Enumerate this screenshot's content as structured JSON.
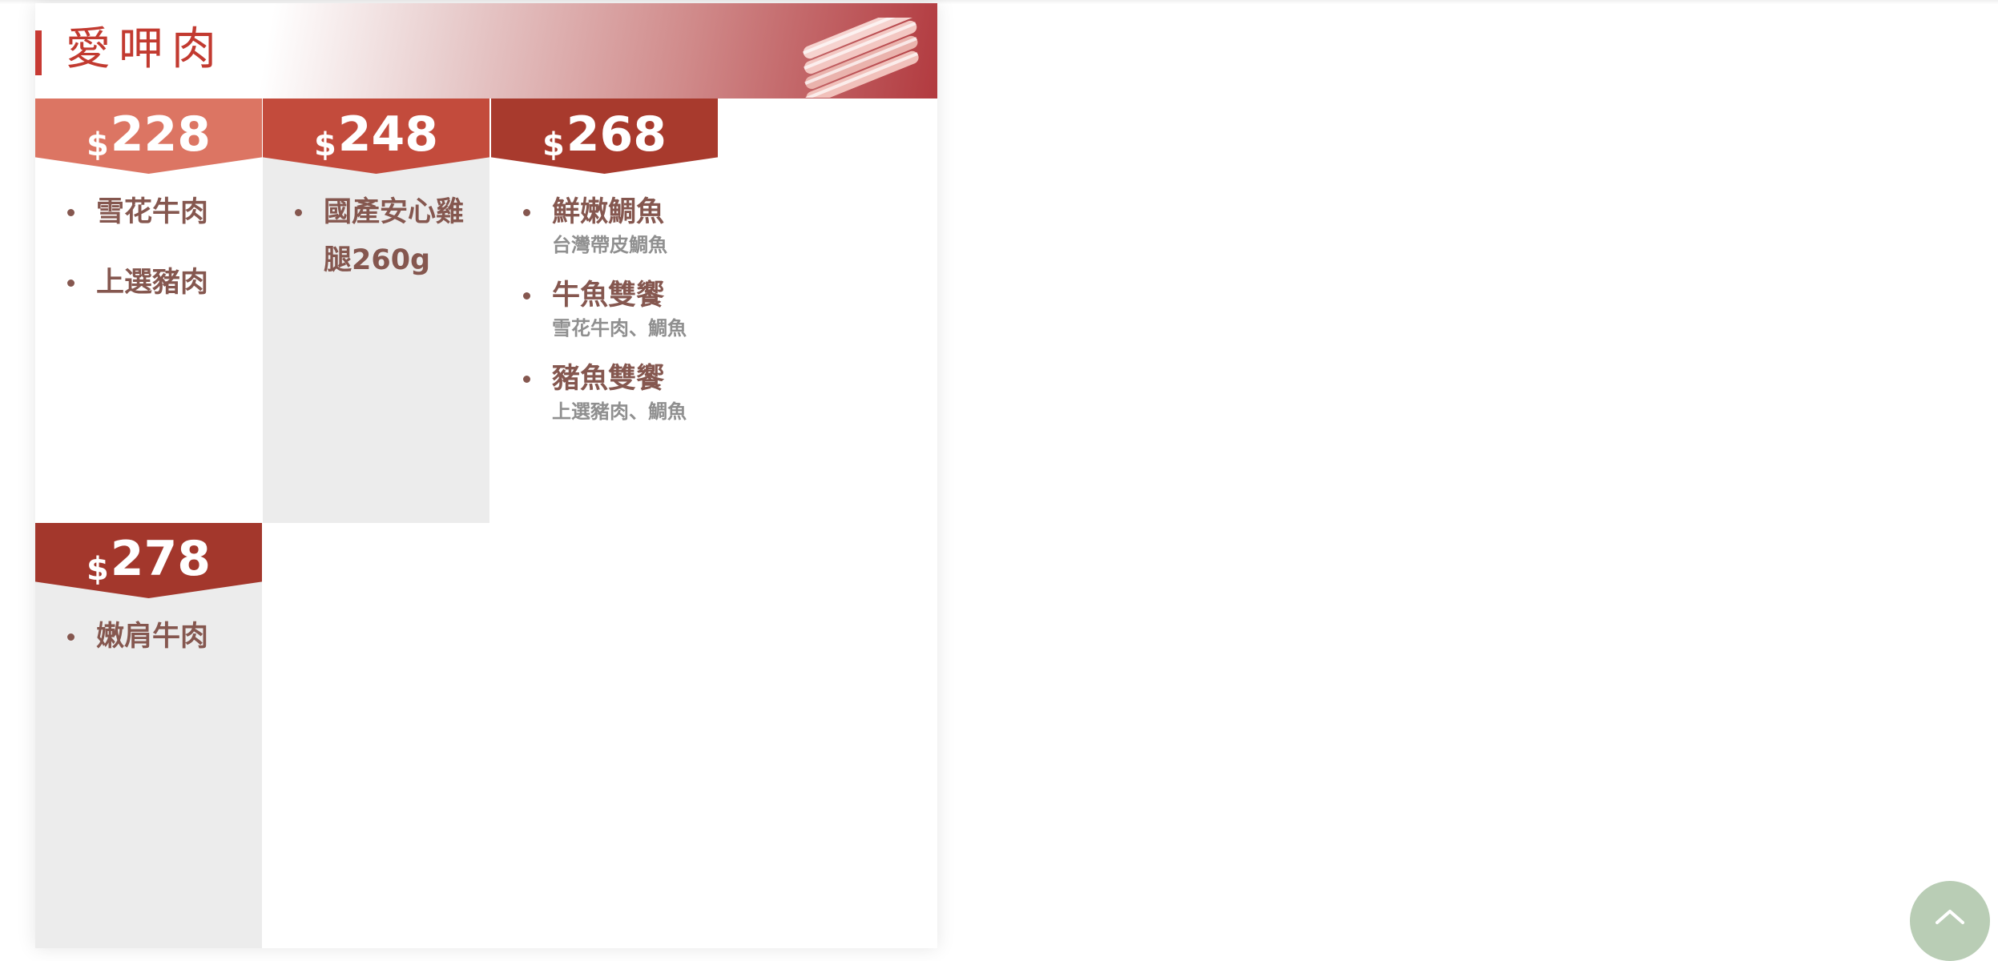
{
  "header": {
    "title": "愛呷肉",
    "image_icon": "bacon-strips-icon"
  },
  "colors": {
    "accent": "#c23a30",
    "tier1": "#dc7563",
    "tier2": "#c34b3c",
    "tier3": "#a83a2d",
    "tier4": "#a3372c",
    "item_text": "#85574f",
    "scroll_button": "#b9cdb5"
  },
  "tiers": [
    {
      "currency": "$",
      "price": "228",
      "items": [
        {
          "name": "雪花牛肉"
        },
        {
          "name": "上選豬肉"
        }
      ]
    },
    {
      "currency": "$",
      "price": "248",
      "items": [
        {
          "name": "國產安心雞腿260g"
        }
      ]
    },
    {
      "currency": "$",
      "price": "268",
      "items": [
        {
          "name": "鮮嫩鯛魚",
          "desc": "台灣帶皮鯛魚"
        },
        {
          "name": "牛魚雙饗",
          "desc": "雪花牛肉、鯛魚"
        },
        {
          "name": "豬魚雙饗",
          "desc": "上選豬肉、鯛魚"
        }
      ]
    },
    {
      "currency": "$",
      "price": "278",
      "items": [
        {
          "name": "嫩肩牛肉"
        }
      ]
    }
  ],
  "scroll_top": {
    "icon": "chevron-up-icon"
  }
}
